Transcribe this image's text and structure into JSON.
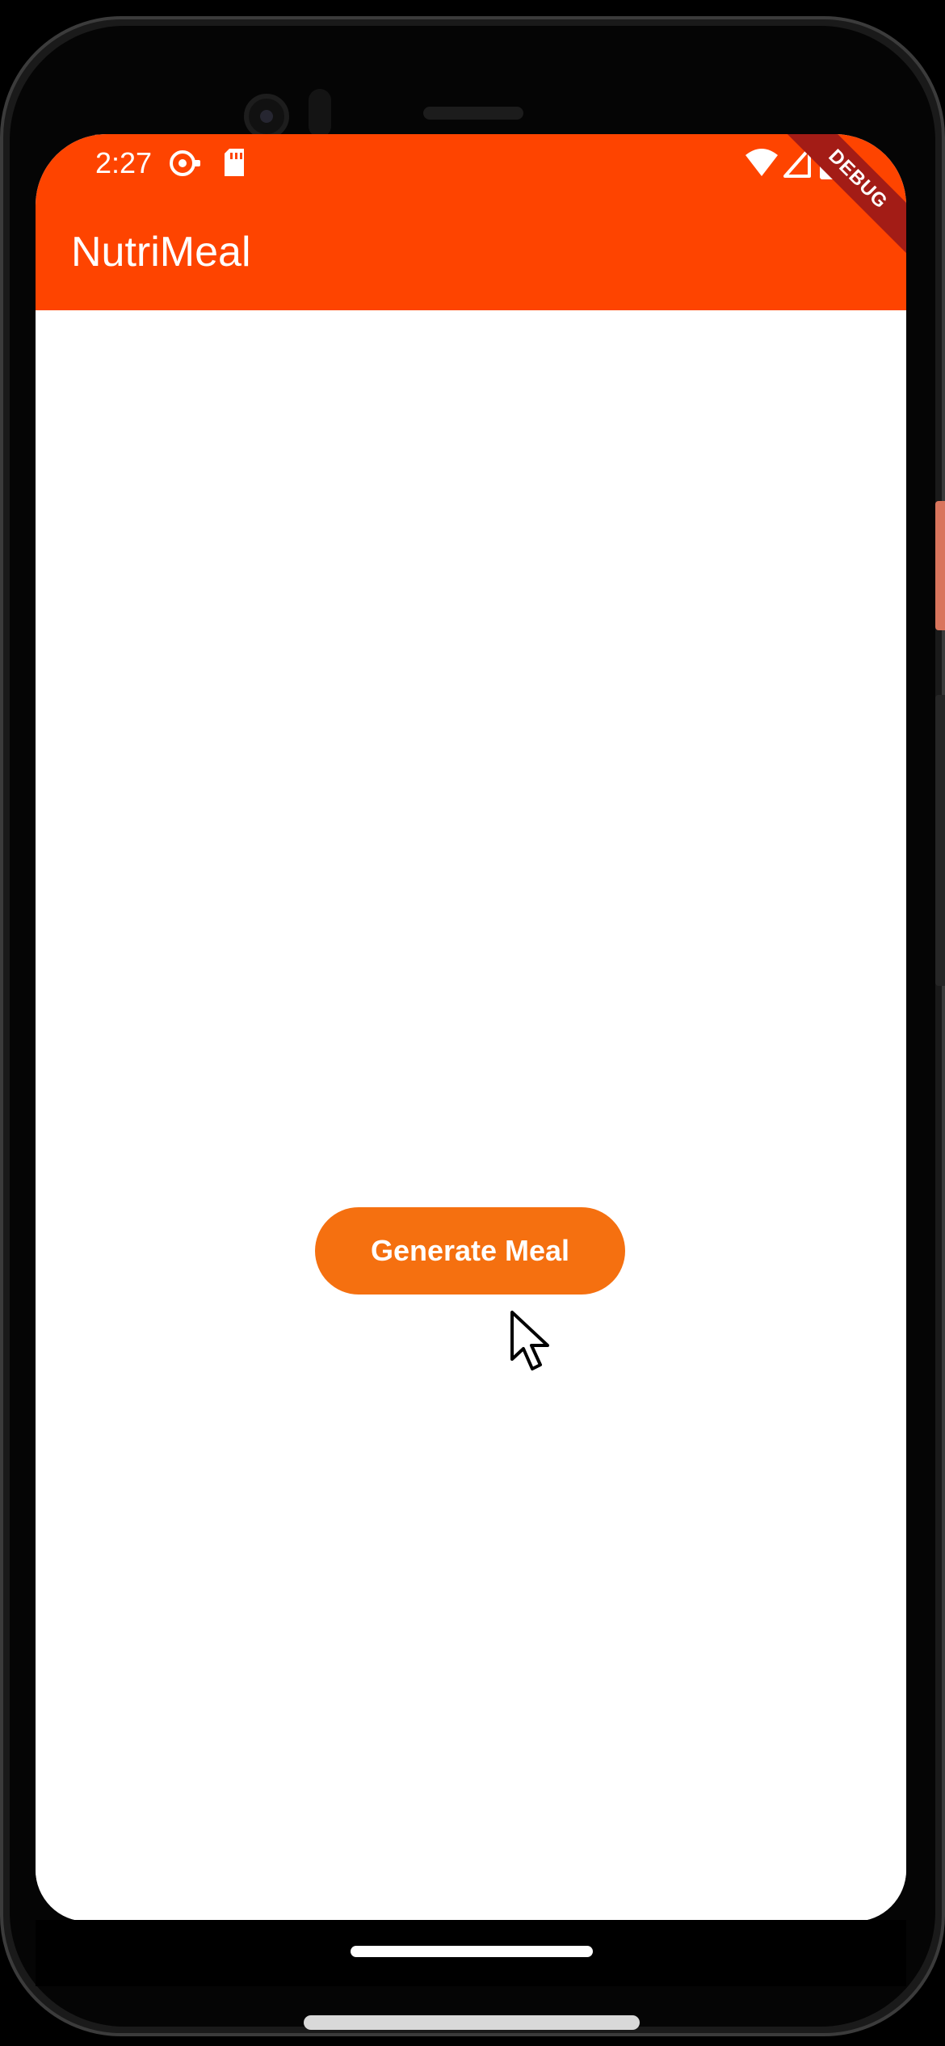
{
  "status_bar": {
    "time": "2:27",
    "icons": [
      "sync-icon",
      "sd-card-icon",
      "wifi-icon",
      "cell-signal-icon",
      "battery-icon"
    ]
  },
  "app_bar": {
    "title": "NutriMeal",
    "debug_banner": "DEBUG"
  },
  "main": {
    "generate_button_label": "Generate Meal"
  },
  "colors": {
    "primary": "#fe4400",
    "button": "#f57010",
    "background": "#ffffff",
    "debug_banner": "#a31c16"
  }
}
